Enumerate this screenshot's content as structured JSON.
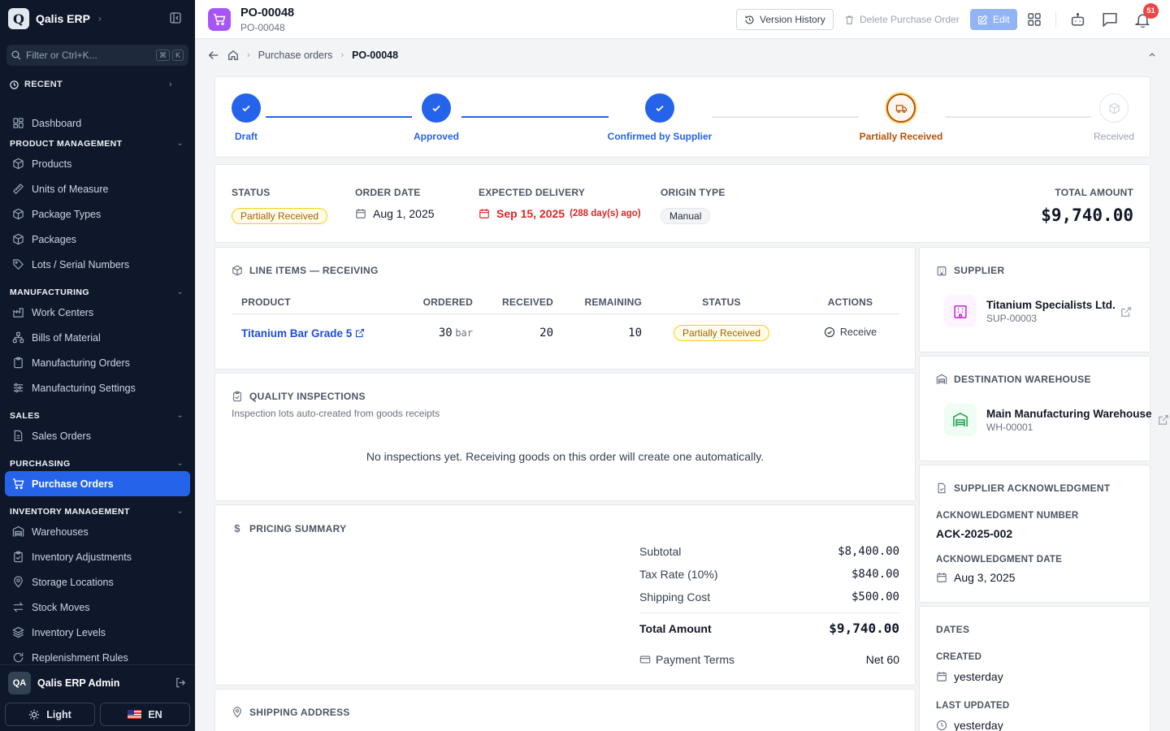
{
  "app": {
    "name": "Qalis ERP",
    "logo_letter": "Q"
  },
  "sidebar": {
    "filter_placeholder": "Filter or Ctrl+K...",
    "kbd": [
      "⌘",
      "K"
    ],
    "recent_label": "RECENT",
    "dashboard": "Dashboard",
    "sections": [
      {
        "title": "PRODUCT MANAGEMENT",
        "items": [
          "Products",
          "Units of Measure",
          "Package Types",
          "Packages",
          "Lots / Serial Numbers"
        ]
      },
      {
        "title": "MANUFACTURING",
        "items": [
          "Work Centers",
          "Bills of Material",
          "Manufacturing Orders",
          "Manufacturing Settings"
        ]
      },
      {
        "title": "SALES",
        "items": [
          "Sales Orders"
        ]
      },
      {
        "title": "PURCHASING",
        "items": [
          "Purchase Orders"
        ]
      },
      {
        "title": "INVENTORY MANAGEMENT",
        "items": [
          "Warehouses",
          "Inventory Adjustments",
          "Storage Locations",
          "Stock Moves",
          "Inventory Levels",
          "Replenishment Rules"
        ]
      }
    ],
    "active_item": "Purchase Orders",
    "user": {
      "initials": "QA",
      "name": "Qalis ERP Admin"
    },
    "theme_label": "Light",
    "lang_label": "EN"
  },
  "topbar": {
    "title": "PO-00048",
    "subtitle": "PO-00048",
    "version_history": "Version History",
    "delete": "Delete Purchase Order",
    "edit": "Edit",
    "notification_count": "51"
  },
  "breadcrumb": {
    "parent": "Purchase orders",
    "current": "PO-00048"
  },
  "stepper": [
    {
      "label": "Draft",
      "state": "done"
    },
    {
      "label": "Approved",
      "state": "done"
    },
    {
      "label": "Confirmed by Supplier",
      "state": "done"
    },
    {
      "label": "Partially Received",
      "state": "current"
    },
    {
      "label": "Received",
      "state": "pending"
    }
  ],
  "summary": {
    "status_label": "STATUS",
    "status_value": "Partially Received",
    "order_date_label": "ORDER DATE",
    "order_date": "Aug 1, 2025",
    "expected_label": "EXPECTED DELIVERY",
    "expected_date": "Sep 15, 2025",
    "expected_note": "(288 day(s) ago)",
    "origin_label": "ORIGIN TYPE",
    "origin_value": "Manual",
    "total_label": "TOTAL AMOUNT",
    "total_value": "$9,740.00"
  },
  "line_items": {
    "title": "LINE ITEMS — RECEIVING",
    "headers": [
      "PRODUCT",
      "ORDERED",
      "RECEIVED",
      "REMAINING",
      "STATUS",
      "ACTIONS"
    ],
    "rows": [
      {
        "product": "Titanium Bar Grade 5",
        "ordered": "30",
        "unit": "bar",
        "received": "20",
        "remaining": "10",
        "status": "Partially Received",
        "action": "Receive"
      }
    ]
  },
  "quality": {
    "title": "QUALITY INSPECTIONS",
    "subtitle": "Inspection lots auto-created from goods receipts",
    "empty": "No inspections yet. Receiving goods on this order will create one automatically."
  },
  "pricing": {
    "title": "PRICING SUMMARY",
    "subtotal_label": "Subtotal",
    "subtotal": "$8,400.00",
    "tax_label": "Tax Rate (10%)",
    "tax": "$840.00",
    "shipping_label": "Shipping Cost",
    "shipping": "$500.00",
    "total_label": "Total Amount",
    "total": "$9,740.00",
    "terms_label": "Payment Terms",
    "terms": "Net 60"
  },
  "shipping_address": {
    "title": "SHIPPING ADDRESS"
  },
  "supplier": {
    "title": "SUPPLIER",
    "name": "Titanium Specialists Ltd.",
    "code": "SUP-00003"
  },
  "warehouse": {
    "title": "DESTINATION WAREHOUSE",
    "name": "Main Manufacturing Warehouse",
    "code": "WH-00001"
  },
  "acknowledgment": {
    "title": "SUPPLIER ACKNOWLEDGMENT",
    "number_label": "ACKNOWLEDGMENT NUMBER",
    "number": "ACK-2025-002",
    "date_label": "ACKNOWLEDGMENT DATE",
    "date": "Aug 3, 2025"
  },
  "dates": {
    "title": "DATES",
    "created_label": "CREATED",
    "created": "yesterday",
    "updated_label": "LAST UPDATED",
    "updated": "yesterday"
  },
  "colors": {
    "primary": "#2563eb",
    "sidebar_bg": "#0f172a",
    "accent_purple": "#a855f7",
    "amber": "#b45309",
    "danger": "#dc2626"
  }
}
